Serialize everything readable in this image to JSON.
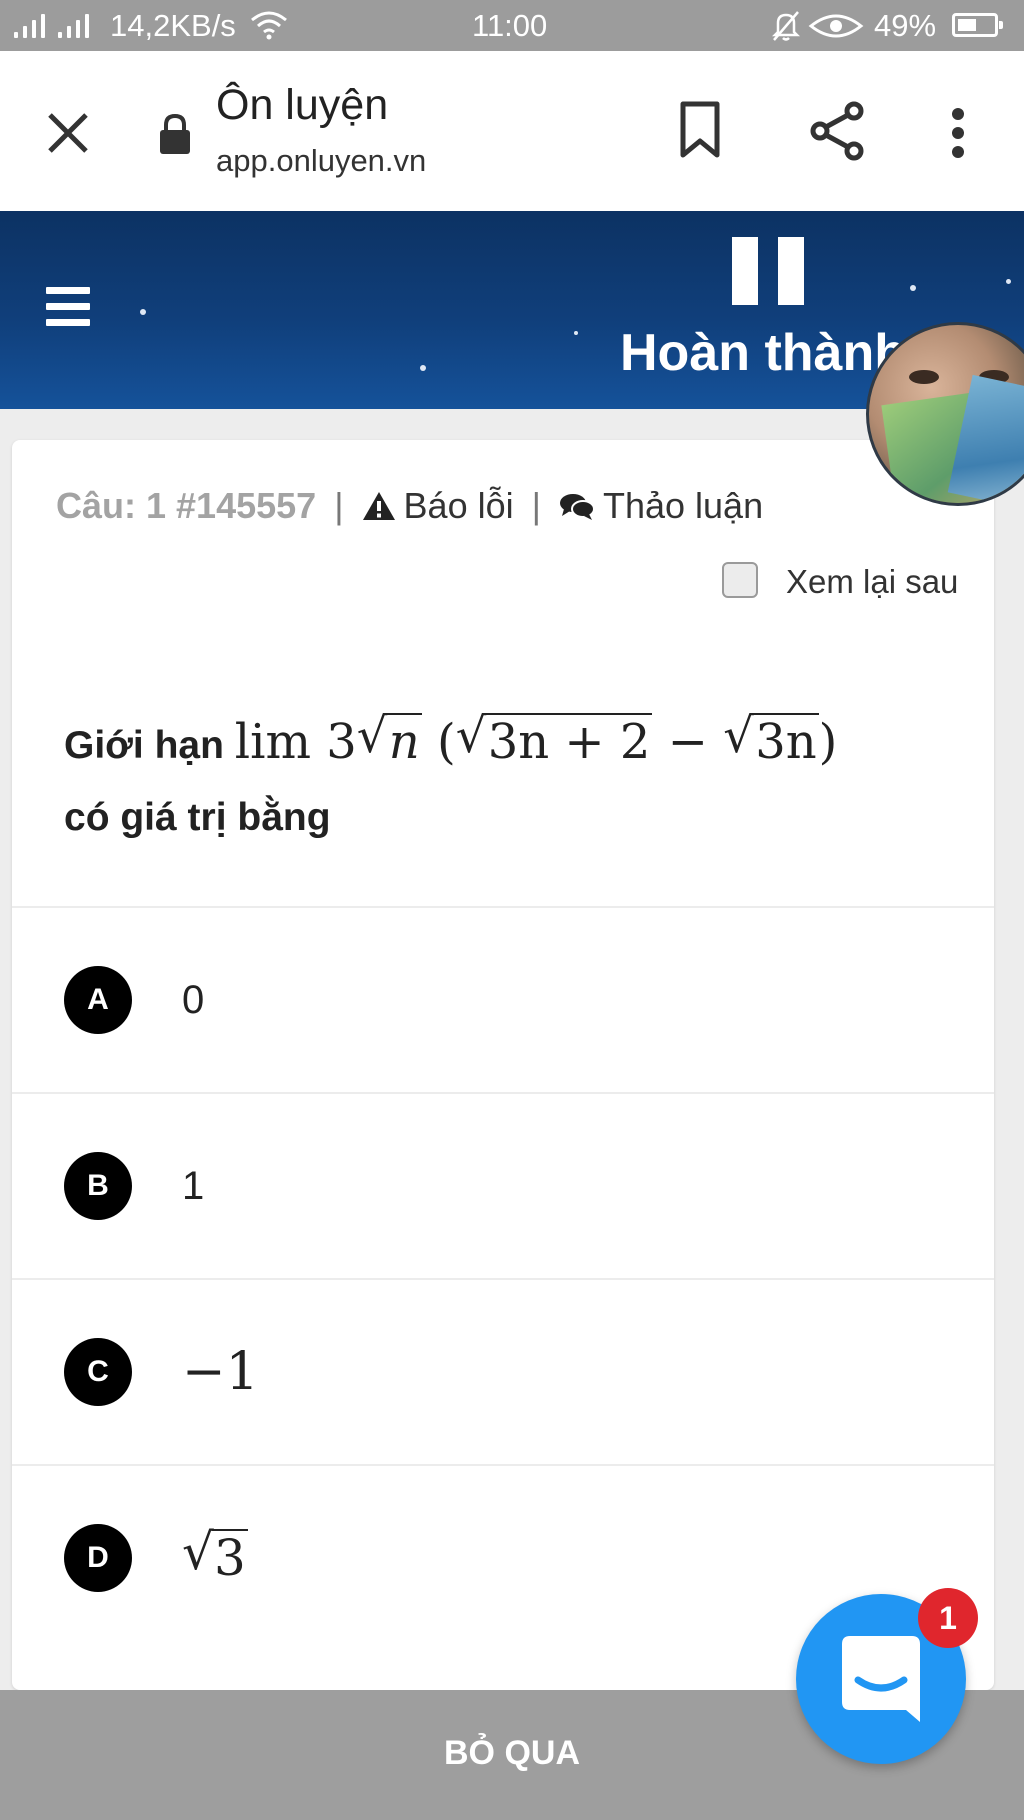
{
  "status_bar": {
    "network_speed": "14,2KB/s",
    "time": "11:00",
    "battery": "49%",
    "icons": [
      "signal-icon",
      "signal-icon",
      "wifi-icon",
      "mute-icon",
      "eye-icon",
      "battery-icon"
    ]
  },
  "browser": {
    "title": "Ôn luyện",
    "url": "app.onluyen.vn",
    "icons": [
      "close-icon",
      "lock-icon",
      "bookmark-icon",
      "share-icon",
      "more-vert-icon"
    ]
  },
  "header": {
    "finish_label": "Hoàn thành",
    "icons": [
      "menu-icon",
      "pause-icon"
    ]
  },
  "question": {
    "number_label": "Câu: 1 #145557",
    "separator": "|",
    "report_label": "Báo lỗi",
    "discuss_label": "Thảo luận",
    "review_later_label": "Xem lại sau",
    "review_later_checked": false,
    "text_prefix": "Giới hạn",
    "text_suffix": "có giá trị bằng",
    "math": {
      "lim": "lim",
      "coef": "3",
      "sqrt_n": "n",
      "open_paren": "(",
      "sqrt_a": "3n + 2",
      "minus": "−",
      "sqrt_b": "3n",
      "close_paren": ")"
    }
  },
  "choices": [
    {
      "letter": "A",
      "value": "0"
    },
    {
      "letter": "B",
      "value": "1"
    },
    {
      "letter": "C",
      "value": "−1"
    },
    {
      "letter": "D",
      "value": "3",
      "radical": true
    }
  ],
  "footer": {
    "skip_label": "BỎ QUA"
  },
  "chat": {
    "badge_count": "1"
  },
  "colors": {
    "header_dark": "#0c3263",
    "header_light": "#15529a",
    "chat_blue": "#2196f3",
    "badge_red": "#e0262d",
    "skip_bar": "#9e9e9e"
  }
}
